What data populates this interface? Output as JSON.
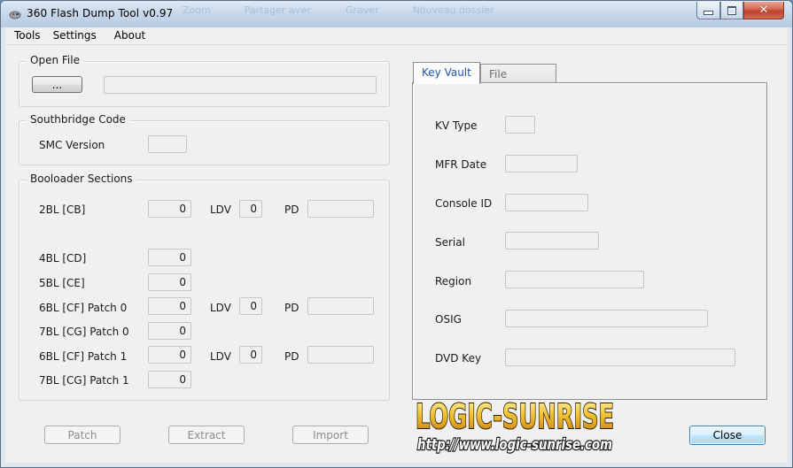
{
  "window": {
    "title": "360 Flash Dump Tool  v0.97",
    "ghost_menu": [
      "Zoom",
      "Partager avec",
      "Graver",
      "Nouveau dossier"
    ]
  },
  "menu": [
    "Tools",
    "Settings",
    "About"
  ],
  "open_file": {
    "label": "Open File",
    "browse_label": "...",
    "path_value": ""
  },
  "southbridge": {
    "label": "Southbridge Code",
    "smc_label": "SMC Version",
    "smc_value": ""
  },
  "bootloader": {
    "label": "Booloader Sections",
    "ldv_label": "LDV",
    "pd_label": "PD",
    "rows": [
      {
        "name": "2BL [CB]",
        "value": "0",
        "ldv": "0",
        "pd": ""
      },
      {
        "name": "4BL [CD]",
        "value": "0"
      },
      {
        "name": "5BL [CE]",
        "value": "0"
      },
      {
        "name": "6BL [CF] Patch 0",
        "value": "0",
        "ldv": "0",
        "pd": ""
      },
      {
        "name": "7BL [CG] Patch 0",
        "value": "0"
      },
      {
        "name": "6BL [CF] Patch 1",
        "value": "0",
        "ldv": "0",
        "pd": ""
      },
      {
        "name": "7BL [CG] Patch 1",
        "value": "0"
      }
    ]
  },
  "tabs": [
    {
      "label": "Key Vault",
      "active": true
    },
    {
      "label": "File System",
      "active": false
    }
  ],
  "key_vault": [
    {
      "label": "KV Type",
      "value": ""
    },
    {
      "label": "MFR Date",
      "value": ""
    },
    {
      "label": "Console ID",
      "value": ""
    },
    {
      "label": "Serial",
      "value": ""
    },
    {
      "label": "Region",
      "value": ""
    },
    {
      "label": "OSIG",
      "value": ""
    },
    {
      "label": "DVD Key",
      "value": ""
    }
  ],
  "buttons": {
    "patch": "Patch",
    "extract": "Extract",
    "import": "Import",
    "close": "Close"
  },
  "watermark": {
    "brand": "LOGIC-SUNRISE",
    "url": "http://www.logic-sunrise.com"
  },
  "colors": {
    "active_tab_text": "#1e5aa8",
    "close_button_border": "#3c7fb1",
    "watermark_fill": "#f2c230"
  }
}
